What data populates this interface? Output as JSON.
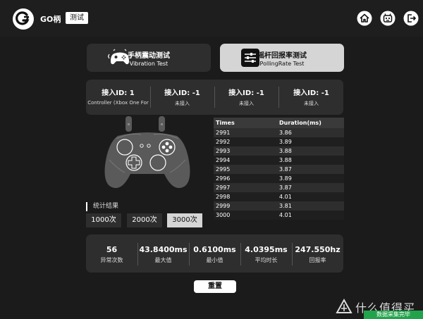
{
  "header": {
    "logo_text": "GO柄",
    "mode_badge": "测试",
    "icons": [
      "home-icon",
      "robot-icon",
      "exit-icon"
    ]
  },
  "modes": [
    {
      "title": "手柄震动测试",
      "subtitle": "Vibration Test",
      "icon": "gamepad-vibration-icon",
      "active": false
    },
    {
      "title": "摇杆回报率测试",
      "subtitle": "PollingRate Test",
      "icon": "sliders-icon",
      "active": true
    }
  ],
  "ids": [
    {
      "label": "接入ID: 1",
      "status": "Controller (Xbox One For"
    },
    {
      "label": "接入ID: -1",
      "status": "未接入"
    },
    {
      "label": "接入ID: -1",
      "status": "未接入"
    },
    {
      "label": "接入ID: -1",
      "status": "未接入"
    }
  ],
  "stats": {
    "label": "统计结果",
    "buttons": [
      "1000次",
      "2000次",
      "3000次"
    ],
    "selected": "3000次"
  },
  "table": {
    "headers": [
      "Times",
      "Duration(ms)"
    ],
    "rows": [
      [
        "2991",
        "3.86"
      ],
      [
        "2992",
        "3.89"
      ],
      [
        "2993",
        "3.88"
      ],
      [
        "2994",
        "3.88"
      ],
      [
        "2995",
        "3.87"
      ],
      [
        "2996",
        "3.89"
      ],
      [
        "2997",
        "3.87"
      ],
      [
        "2998",
        "4.01"
      ],
      [
        "2999",
        "3.81"
      ],
      [
        "3000",
        "4.01"
      ]
    ]
  },
  "summary": [
    {
      "value": "56",
      "label": "异常次数"
    },
    {
      "value": "43.8400ms",
      "label": "最大值"
    },
    {
      "value": "0.6100ms",
      "label": "最小值"
    },
    {
      "value": "4.0395ms",
      "label": "平均时长"
    },
    {
      "value": "247.550hz",
      "label": "回报率"
    }
  ],
  "reset_label": "重置",
  "watermark": {
    "text": "什么值得买",
    "tag": "数据采集完毕"
  },
  "colors": {
    "background": "#1b1b1b",
    "panel": "#2e2e2e",
    "active": "#d5d5d5",
    "accent_green": "#22a34b"
  }
}
